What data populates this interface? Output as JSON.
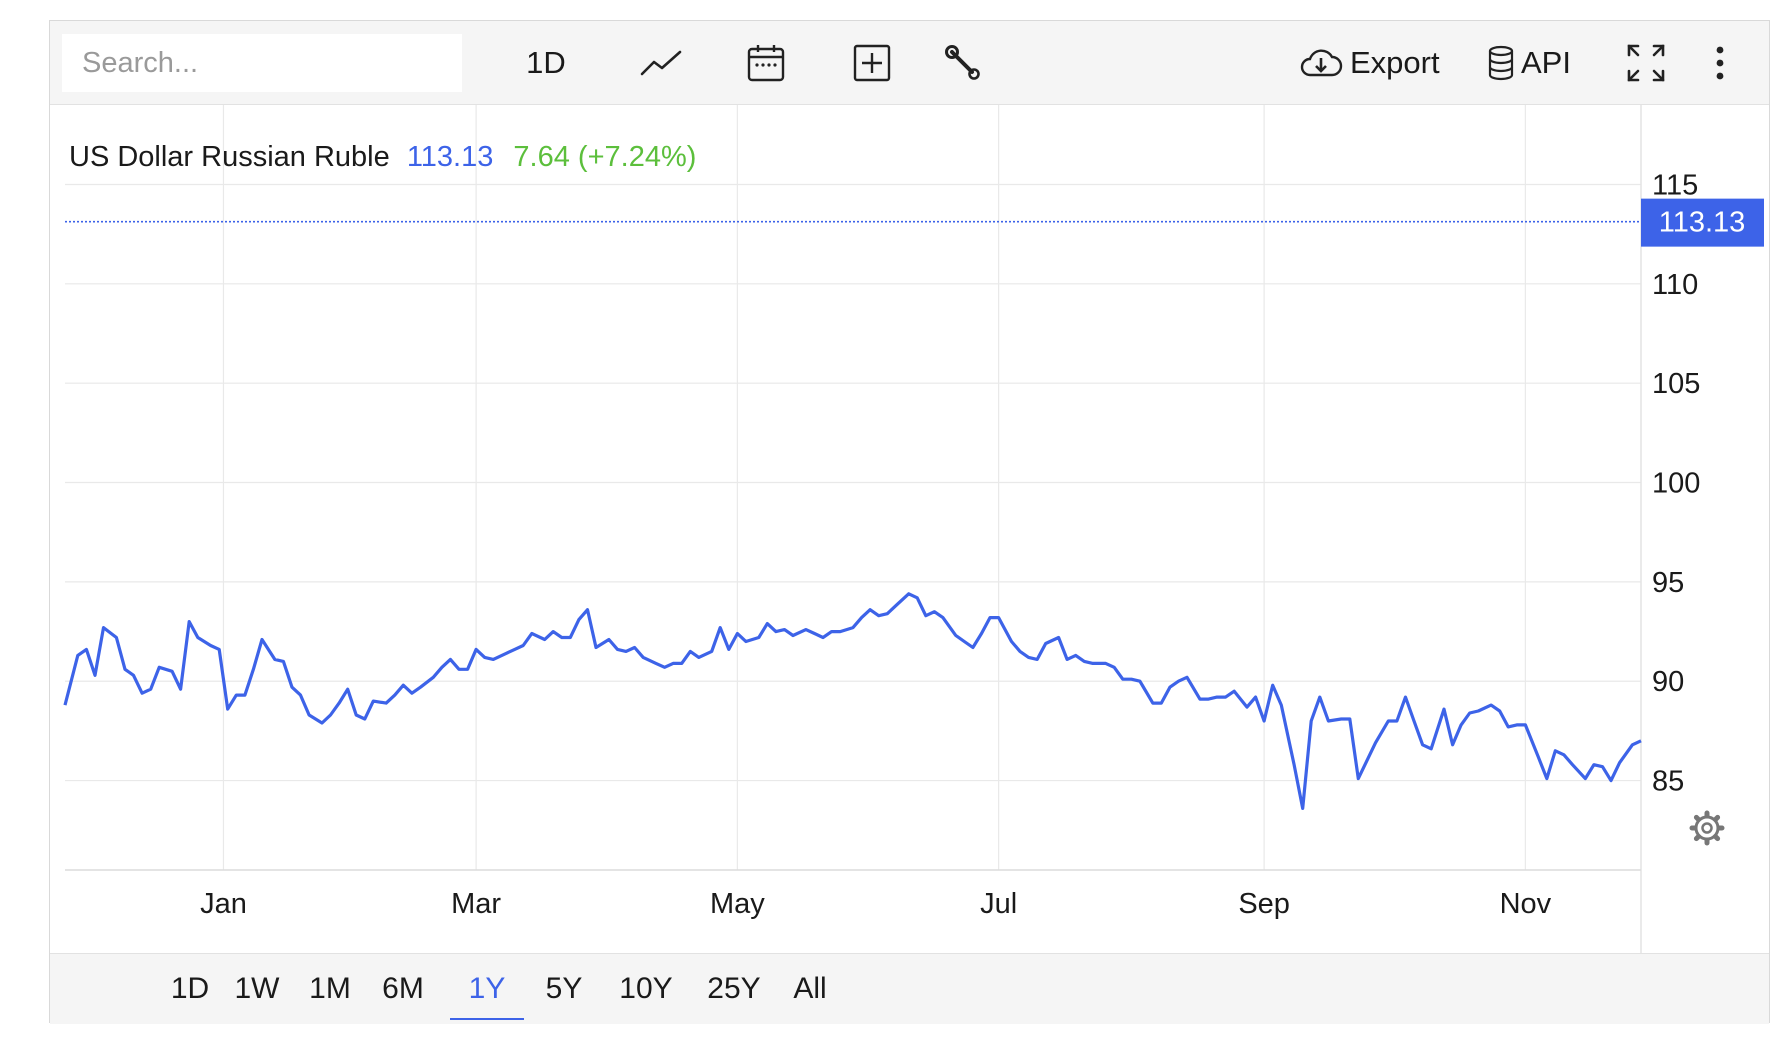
{
  "toolbar": {
    "search_placeholder": "Search...",
    "interval_label": "1D",
    "export_label": "Export",
    "api_label": "API",
    "icons": [
      "line-chart-icon",
      "calendar-icon",
      "add-box-icon",
      "wrench-icon",
      "cloud-download-icon",
      "database-icon",
      "fullscreen-icon",
      "more-vertical-icon"
    ]
  },
  "header": {
    "name": "US Dollar Russian Ruble",
    "last": "113.13",
    "change": "7.64 (+7.24%)"
  },
  "colors": {
    "line": "#3d63e8",
    "change": "#5cbf3c",
    "grid": "#e9e9e9",
    "price_tag_bg": "#3d63e8"
  },
  "settings_icon": "gear-icon",
  "range_buttons": {
    "labels": [
      "1D",
      "1W",
      "1M",
      "6M",
      "1Y",
      "5Y",
      "10Y",
      "25Y",
      "All"
    ],
    "active": "1Y"
  },
  "chart_data": {
    "type": "line",
    "title": "US Dollar Russian Ruble",
    "last_value": 113.13,
    "last_label": "113.13",
    "ylim": [
      80.5,
      119
    ],
    "yticks": [
      85,
      90,
      95,
      100,
      105,
      110,
      115
    ],
    "xlim": [
      "2024-11-25",
      "2025-11-28"
    ],
    "xticks": [
      {
        "label": "Jan",
        "date": "2025-01-01"
      },
      {
        "label": "Mar",
        "date": "2025-03-01"
      },
      {
        "label": "May",
        "date": "2025-05-01"
      },
      {
        "label": "Jul",
        "date": "2025-07-01"
      },
      {
        "label": "Sep",
        "date": "2025-09-01"
      },
      {
        "label": "Nov",
        "date": "2025-11-01"
      }
    ],
    "grid": true,
    "series": [
      {
        "points": [
          [
            "2024-11-25",
            88.8
          ],
          [
            "2024-11-28",
            91.3
          ],
          [
            "2024-11-30",
            91.6
          ],
          [
            "2024-12-02",
            90.3
          ],
          [
            "2024-12-04",
            92.7
          ],
          [
            "2024-12-07",
            92.2
          ],
          [
            "2024-12-09",
            90.6
          ],
          [
            "2024-12-11",
            90.3
          ],
          [
            "2024-12-13",
            89.4
          ],
          [
            "2024-12-15",
            89.6
          ],
          [
            "2024-12-17",
            90.7
          ],
          [
            "2024-12-20",
            90.5
          ],
          [
            "2024-12-22",
            89.6
          ],
          [
            "2024-12-24",
            93.0
          ],
          [
            "2024-12-26",
            92.2
          ],
          [
            "2024-12-29",
            91.8
          ],
          [
            "2024-12-31",
            91.6
          ],
          [
            "2025-01-02",
            88.6
          ],
          [
            "2025-01-04",
            89.3
          ],
          [
            "2025-01-06",
            89.3
          ],
          [
            "2025-01-08",
            90.6
          ],
          [
            "2025-01-10",
            92.1
          ],
          [
            "2025-01-13",
            91.1
          ],
          [
            "2025-01-15",
            91.0
          ],
          [
            "2025-01-17",
            89.7
          ],
          [
            "2025-01-19",
            89.3
          ],
          [
            "2025-01-21",
            88.3
          ],
          [
            "2025-01-24",
            87.9
          ],
          [
            "2025-01-26",
            88.3
          ],
          [
            "2025-01-28",
            88.9
          ],
          [
            "2025-01-30",
            89.6
          ],
          [
            "2025-02-01",
            88.3
          ],
          [
            "2025-02-03",
            88.1
          ],
          [
            "2025-02-05",
            89.0
          ],
          [
            "2025-02-08",
            88.9
          ],
          [
            "2025-02-10",
            89.3
          ],
          [
            "2025-02-12",
            89.8
          ],
          [
            "2025-02-14",
            89.4
          ],
          [
            "2025-02-16",
            89.7
          ],
          [
            "2025-02-19",
            90.2
          ],
          [
            "2025-02-21",
            90.7
          ],
          [
            "2025-02-23",
            91.1
          ],
          [
            "2025-02-25",
            90.6
          ],
          [
            "2025-02-27",
            90.6
          ],
          [
            "2025-03-01",
            91.6
          ],
          [
            "2025-03-03",
            91.2
          ],
          [
            "2025-03-05",
            91.1
          ],
          [
            "2025-03-08",
            91.4
          ],
          [
            "2025-03-10",
            91.6
          ],
          [
            "2025-03-12",
            91.8
          ],
          [
            "2025-03-14",
            92.4
          ],
          [
            "2025-03-17",
            92.1
          ],
          [
            "2025-03-19",
            92.5
          ],
          [
            "2025-03-21",
            92.2
          ],
          [
            "2025-03-23",
            92.2
          ],
          [
            "2025-03-25",
            93.1
          ],
          [
            "2025-03-27",
            93.6
          ],
          [
            "2025-03-29",
            91.7
          ],
          [
            "2025-04-01",
            92.1
          ],
          [
            "2025-04-03",
            91.6
          ],
          [
            "2025-04-05",
            91.5
          ],
          [
            "2025-04-07",
            91.7
          ],
          [
            "2025-04-09",
            91.2
          ],
          [
            "2025-04-12",
            90.9
          ],
          [
            "2025-04-14",
            90.7
          ],
          [
            "2025-04-16",
            90.9
          ],
          [
            "2025-04-18",
            90.9
          ],
          [
            "2025-04-20",
            91.5
          ],
          [
            "2025-04-22",
            91.2
          ],
          [
            "2025-04-25",
            91.5
          ],
          [
            "2025-04-27",
            92.7
          ],
          [
            "2025-04-29",
            91.6
          ],
          [
            "2025-05-01",
            92.4
          ],
          [
            "2025-05-03",
            92.0
          ],
          [
            "2025-05-06",
            92.2
          ],
          [
            "2025-05-08",
            92.9
          ],
          [
            "2025-05-10",
            92.5
          ],
          [
            "2025-05-12",
            92.6
          ],
          [
            "2025-05-14",
            92.3
          ],
          [
            "2025-05-17",
            92.6
          ],
          [
            "2025-05-19",
            92.4
          ],
          [
            "2025-05-21",
            92.2
          ],
          [
            "2025-05-23",
            92.5
          ],
          [
            "2025-05-25",
            92.5
          ],
          [
            "2025-05-28",
            92.7
          ],
          [
            "2025-05-30",
            93.2
          ],
          [
            "2025-06-01",
            93.6
          ],
          [
            "2025-06-03",
            93.3
          ],
          [
            "2025-06-05",
            93.4
          ],
          [
            "2025-06-07",
            93.8
          ],
          [
            "2025-06-10",
            94.4
          ],
          [
            "2025-06-12",
            94.2
          ],
          [
            "2025-06-14",
            93.3
          ],
          [
            "2025-06-16",
            93.5
          ],
          [
            "2025-06-18",
            93.2
          ],
          [
            "2025-06-21",
            92.3
          ],
          [
            "2025-06-23",
            92.0
          ],
          [
            "2025-06-25",
            91.7
          ],
          [
            "2025-06-27",
            92.4
          ],
          [
            "2025-06-29",
            93.2
          ],
          [
            "2025-07-01",
            93.2
          ],
          [
            "2025-07-04",
            92.0
          ],
          [
            "2025-07-06",
            91.5
          ],
          [
            "2025-07-08",
            91.2
          ],
          [
            "2025-07-10",
            91.1
          ],
          [
            "2025-07-12",
            91.9
          ],
          [
            "2025-07-15",
            92.2
          ],
          [
            "2025-07-17",
            91.1
          ],
          [
            "2025-07-19",
            91.3
          ],
          [
            "2025-07-21",
            91.0
          ],
          [
            "2025-07-23",
            90.9
          ],
          [
            "2025-07-26",
            90.9
          ],
          [
            "2025-07-28",
            90.7
          ],
          [
            "2025-07-30",
            90.1
          ],
          [
            "2025-08-01",
            90.1
          ],
          [
            "2025-08-03",
            90.0
          ],
          [
            "2025-08-06",
            88.9
          ],
          [
            "2025-08-08",
            88.9
          ],
          [
            "2025-08-10",
            89.7
          ],
          [
            "2025-08-12",
            90.0
          ],
          [
            "2025-08-14",
            90.2
          ],
          [
            "2025-08-17",
            89.1
          ],
          [
            "2025-08-19",
            89.1
          ],
          [
            "2025-08-21",
            89.2
          ],
          [
            "2025-08-23",
            89.2
          ],
          [
            "2025-08-25",
            89.5
          ],
          [
            "2025-08-28",
            88.7
          ],
          [
            "2025-08-30",
            89.2
          ],
          [
            "2025-09-01",
            88.0
          ],
          [
            "2025-09-03",
            89.8
          ],
          [
            "2025-09-05",
            88.8
          ],
          [
            "2025-09-08",
            85.8
          ],
          [
            "2025-09-10",
            83.6
          ],
          [
            "2025-09-12",
            88.0
          ],
          [
            "2025-09-14",
            89.2
          ],
          [
            "2025-09-16",
            88.0
          ],
          [
            "2025-09-19",
            88.1
          ],
          [
            "2025-09-21",
            88.1
          ],
          [
            "2025-09-23",
            85.1
          ],
          [
            "2025-09-25",
            86.0
          ],
          [
            "2025-09-27",
            86.9
          ],
          [
            "2025-09-30",
            88.0
          ],
          [
            "2025-10-02",
            88.0
          ],
          [
            "2025-10-04",
            89.2
          ],
          [
            "2025-10-06",
            88.0
          ],
          [
            "2025-10-08",
            86.8
          ],
          [
            "2025-10-10",
            86.6
          ],
          [
            "2025-10-13",
            88.6
          ],
          [
            "2025-10-15",
            86.8
          ],
          [
            "2025-10-17",
            87.8
          ],
          [
            "2025-10-19",
            88.4
          ],
          [
            "2025-10-21",
            88.5
          ],
          [
            "2025-10-24",
            88.8
          ],
          [
            "2025-10-26",
            88.5
          ],
          [
            "2025-10-28",
            87.7
          ],
          [
            "2025-10-30",
            87.8
          ],
          [
            "2025-11-01",
            87.8
          ],
          [
            "2025-11-04",
            86.2
          ],
          [
            "2025-11-06",
            85.1
          ],
          [
            "2025-11-08",
            86.5
          ],
          [
            "2025-11-10",
            86.3
          ],
          [
            "2025-11-12",
            85.8
          ],
          [
            "2025-11-15",
            85.1
          ],
          [
            "2025-11-17",
            85.8
          ],
          [
            "2025-11-19",
            85.7
          ],
          [
            "2025-11-21",
            85.0
          ],
          [
            "2025-11-23",
            85.9
          ],
          [
            "2025-11-26",
            86.8
          ],
          [
            "2025-11-28",
            87.0
          ]
        ]
      }
    ]
  }
}
